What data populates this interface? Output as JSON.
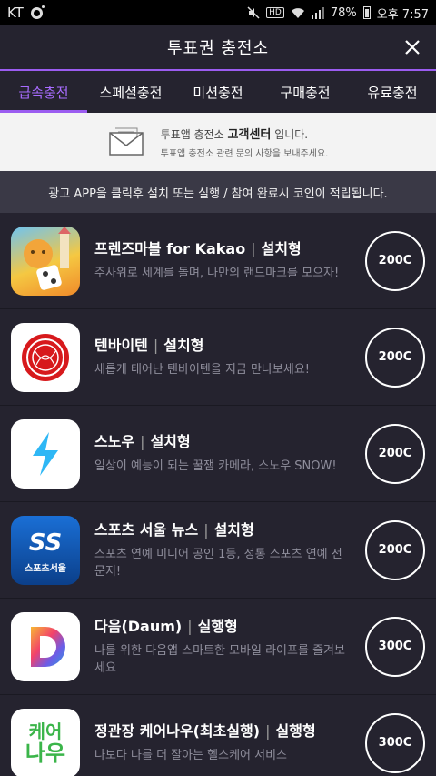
{
  "status_bar": {
    "carrier": "KT",
    "battery": "78%",
    "time": "오후 7:57",
    "hd": "HD"
  },
  "header": {
    "title": "투표권 충전소"
  },
  "tabs": [
    {
      "label": "급속충전"
    },
    {
      "label": "스페셜충전"
    },
    {
      "label": "미션충전"
    },
    {
      "label": "구매충전"
    },
    {
      "label": "유료충전"
    }
  ],
  "service_center": {
    "line1_prefix": "투표앱 충전소 ",
    "line1_bold": "고객센터",
    "line1_suffix": " 입니다.",
    "line2": "투표앱 충전소 관련 문의 사항을 보내주세요."
  },
  "notice": "광고 APP을 클릭후 설치 또는 실행 / 참여 완료시 코인이 적립됩니다.",
  "items": [
    {
      "name": "프렌즈마블 for Kakao",
      "type": "설치형",
      "desc": "주사위로 세계를 돌며, 나만의 랜드마크를 모으자!",
      "reward": "200C",
      "icon": "friends-marble-icon"
    },
    {
      "name": "텐바이텐",
      "type": "설치형",
      "desc": "새롭게 태어난 텐바이텐을 지금 만나보세요!",
      "reward": "200C",
      "icon": "tenbyten-icon"
    },
    {
      "name": "스노우",
      "type": "설치형",
      "desc": "일상이 예능이 되는 꿀잼 카메라, 스노우 SNOW!",
      "reward": "200C",
      "icon": "snow-icon"
    },
    {
      "name": "스포츠 서울 뉴스",
      "type": "설치형",
      "desc": "스포츠 연예 미디어 공인 1등, 정통 스포츠 연예 전문지!",
      "reward": "200C",
      "icon": "sports-seoul-icon",
      "icon_text": "스포츠서울"
    },
    {
      "name": "다음(Daum)",
      "type": "실행형",
      "desc": "나를 위한 다음앱 스마트한 모바일 라이프를 즐겨보세요",
      "reward": "300C",
      "icon": "daum-icon"
    },
    {
      "name": "정관장 케어나우(최초실행)",
      "type": "실행형",
      "desc": "나보다 나를 더 잘아는 헬스케어 서비스",
      "reward": "300C",
      "icon": "carenow-icon",
      "icon_text_top": "케어",
      "icon_text_bottom": "나우"
    }
  ],
  "colors": {
    "accent": "#9b5cf0",
    "background": "#25232f",
    "notice_bg": "#3a3946"
  }
}
